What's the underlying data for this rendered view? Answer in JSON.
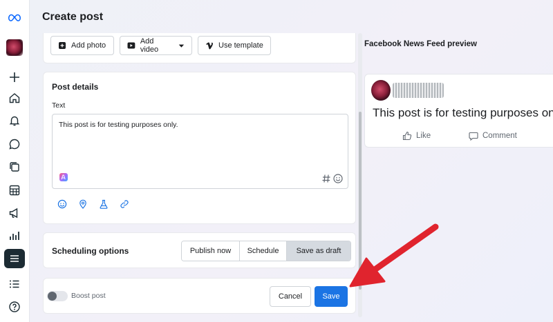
{
  "header": {
    "title": "Create post"
  },
  "media_buttons": {
    "add_photo": "Add photo",
    "add_video": "Add video",
    "use_template": "Use template"
  },
  "post_details": {
    "title": "Post details",
    "text_label": "Text",
    "text_value": "This post is for testing purposes only."
  },
  "scheduling": {
    "title": "Scheduling options",
    "options": [
      "Publish now",
      "Schedule",
      "Save as draft"
    ],
    "selected": "Save as draft"
  },
  "footer": {
    "boost_label": "Boost post",
    "cancel_label": "Cancel",
    "save_label": "Save"
  },
  "preview": {
    "title": "Facebook News Feed preview",
    "post_text": "This post is for testing purposes only.",
    "like_label": "Like",
    "comment_label": "Comment"
  },
  "colors": {
    "primary_button": "#1b74e4",
    "annotation_arrow": "#e0242e",
    "sidebar_active": "#1c2b33"
  },
  "icons": [
    "meta-logo-icon",
    "plus-icon",
    "home-icon",
    "bell-icon",
    "chat-icon",
    "pages-icon",
    "table-icon",
    "megaphone-icon",
    "insights-icon",
    "menu-icon",
    "list-icon",
    "help-icon"
  ]
}
